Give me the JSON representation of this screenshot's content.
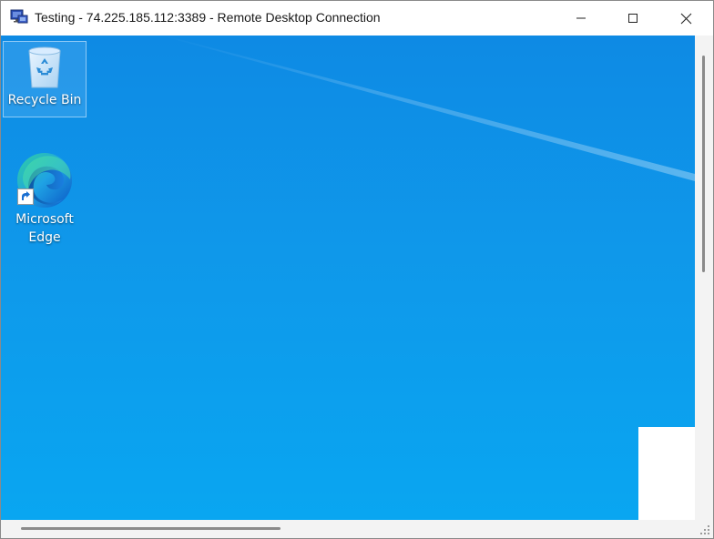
{
  "window": {
    "title": "Testing - 74.225.185.112:3389 - Remote Desktop Connection",
    "app_icon": "remote-desktop-icon",
    "controls": {
      "minimize": "minimize-icon",
      "maximize": "maximize-icon",
      "close": "close-icon"
    }
  },
  "desktop": {
    "background_colors": [
      "#0e8ae4",
      "#09a6f1"
    ],
    "icons": [
      {
        "label": "Recycle Bin",
        "icon": "recycle-bin-icon",
        "selected": true
      },
      {
        "label_line1": "Microsoft",
        "label_line2": "Edge",
        "icon": "edge-icon",
        "shortcut": true
      }
    ]
  }
}
